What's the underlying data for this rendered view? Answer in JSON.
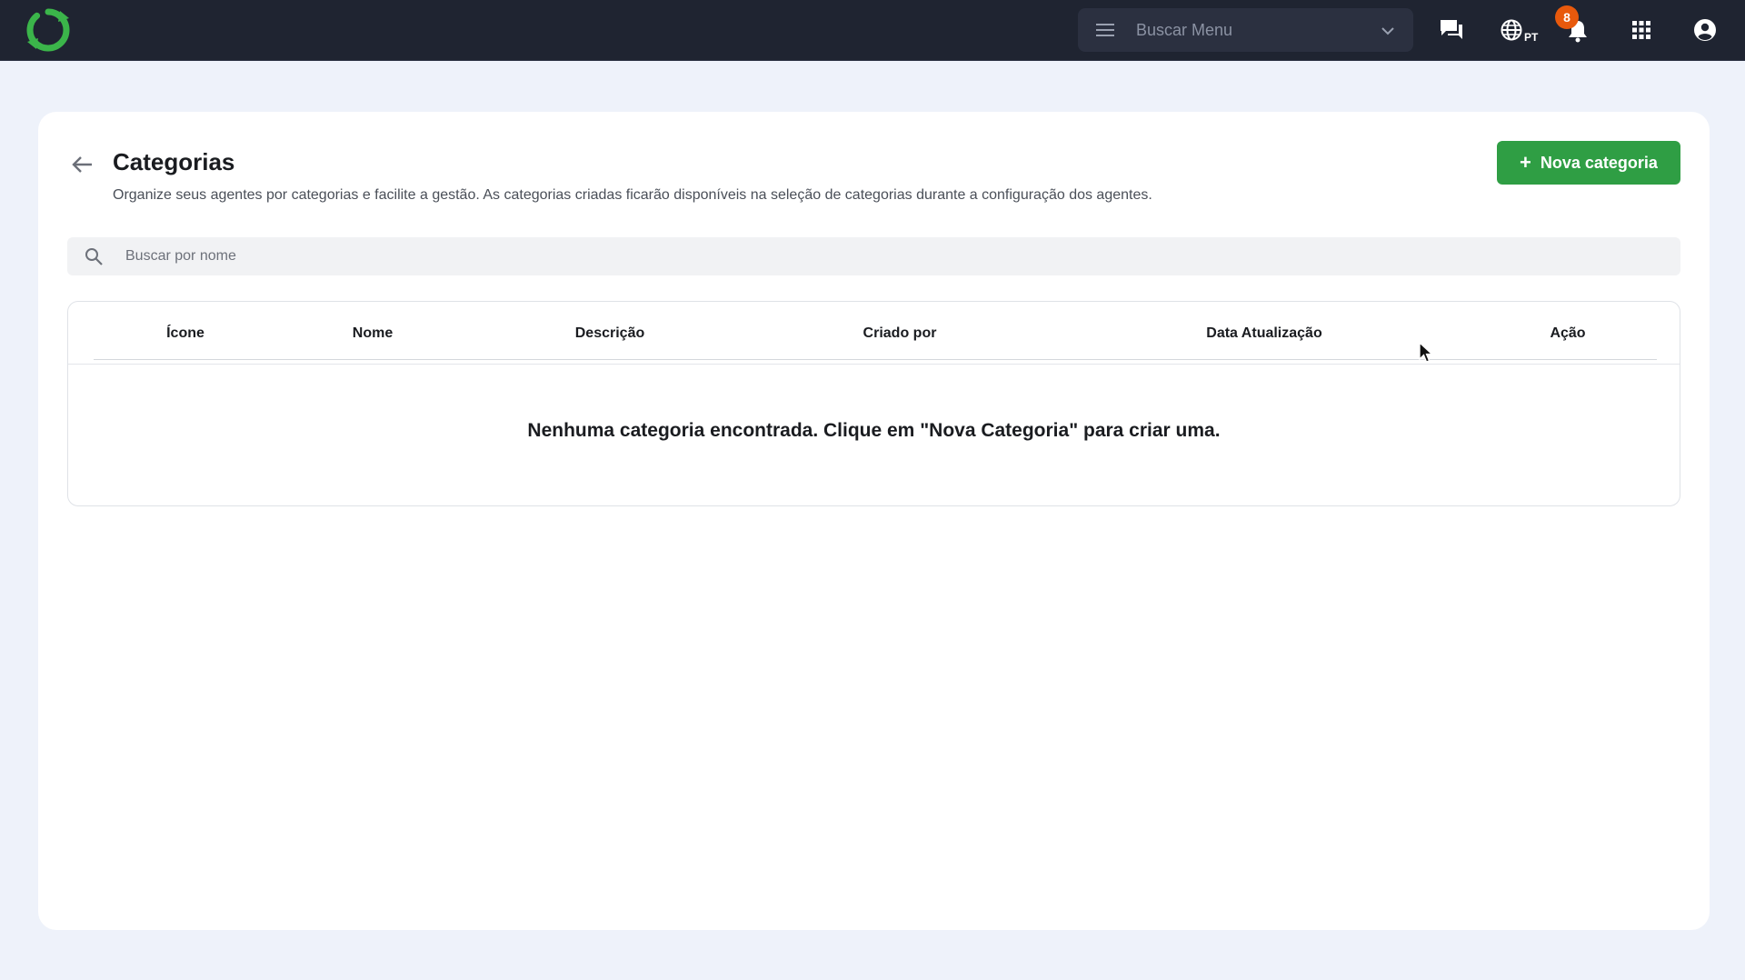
{
  "topbar": {
    "menu_search_placeholder": "Buscar Menu",
    "language_code": "PT",
    "notification_count": "8",
    "brand_color": "#3bb54a"
  },
  "page": {
    "title": "Categorias",
    "subtitle": "Organize seus agentes por categorias e facilite a gestão. As categorias criadas ficarão disponíveis na seleção de categorias durante a configuração dos agentes.",
    "new_button_label": "Nova categoria",
    "accent_color": "#2f9e44"
  },
  "search": {
    "placeholder": "Buscar por nome",
    "value": ""
  },
  "table": {
    "columns": [
      "Ícone",
      "Nome",
      "Descrição",
      "Criado por",
      "Data Atualização",
      "Ação"
    ],
    "rows": [],
    "empty_message": "Nenhuma categoria encontrada. Clique em \"Nova Categoria\" para criar uma."
  }
}
